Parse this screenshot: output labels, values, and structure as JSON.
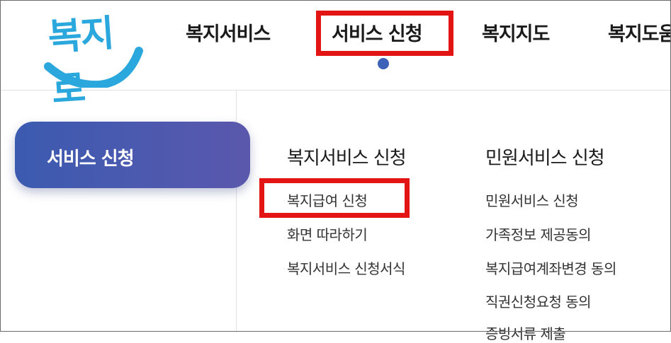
{
  "logo": {
    "text": "복지로"
  },
  "nav": {
    "items": [
      "복지서비스",
      "서비스 신청",
      "복지지도",
      "복지도움"
    ]
  },
  "sidebar": {
    "active_label": "서비스 신청"
  },
  "menu": {
    "col1": {
      "title": "복지서비스 신청",
      "links": [
        "복지급여 신청",
        "화면 따라하기",
        "복지서비스 신청서식"
      ]
    },
    "col2": {
      "title": "민원서비스 신청",
      "links": [
        "민원서비스 신청",
        "가족정보 제공동의",
        "복지급여계좌변경 동의",
        "직권신청요청 동의",
        "증빙서류 제출"
      ]
    }
  },
  "colors": {
    "accent": "#3d62b8",
    "highlight": "#e31414",
    "logo": "#2aa7dc"
  }
}
